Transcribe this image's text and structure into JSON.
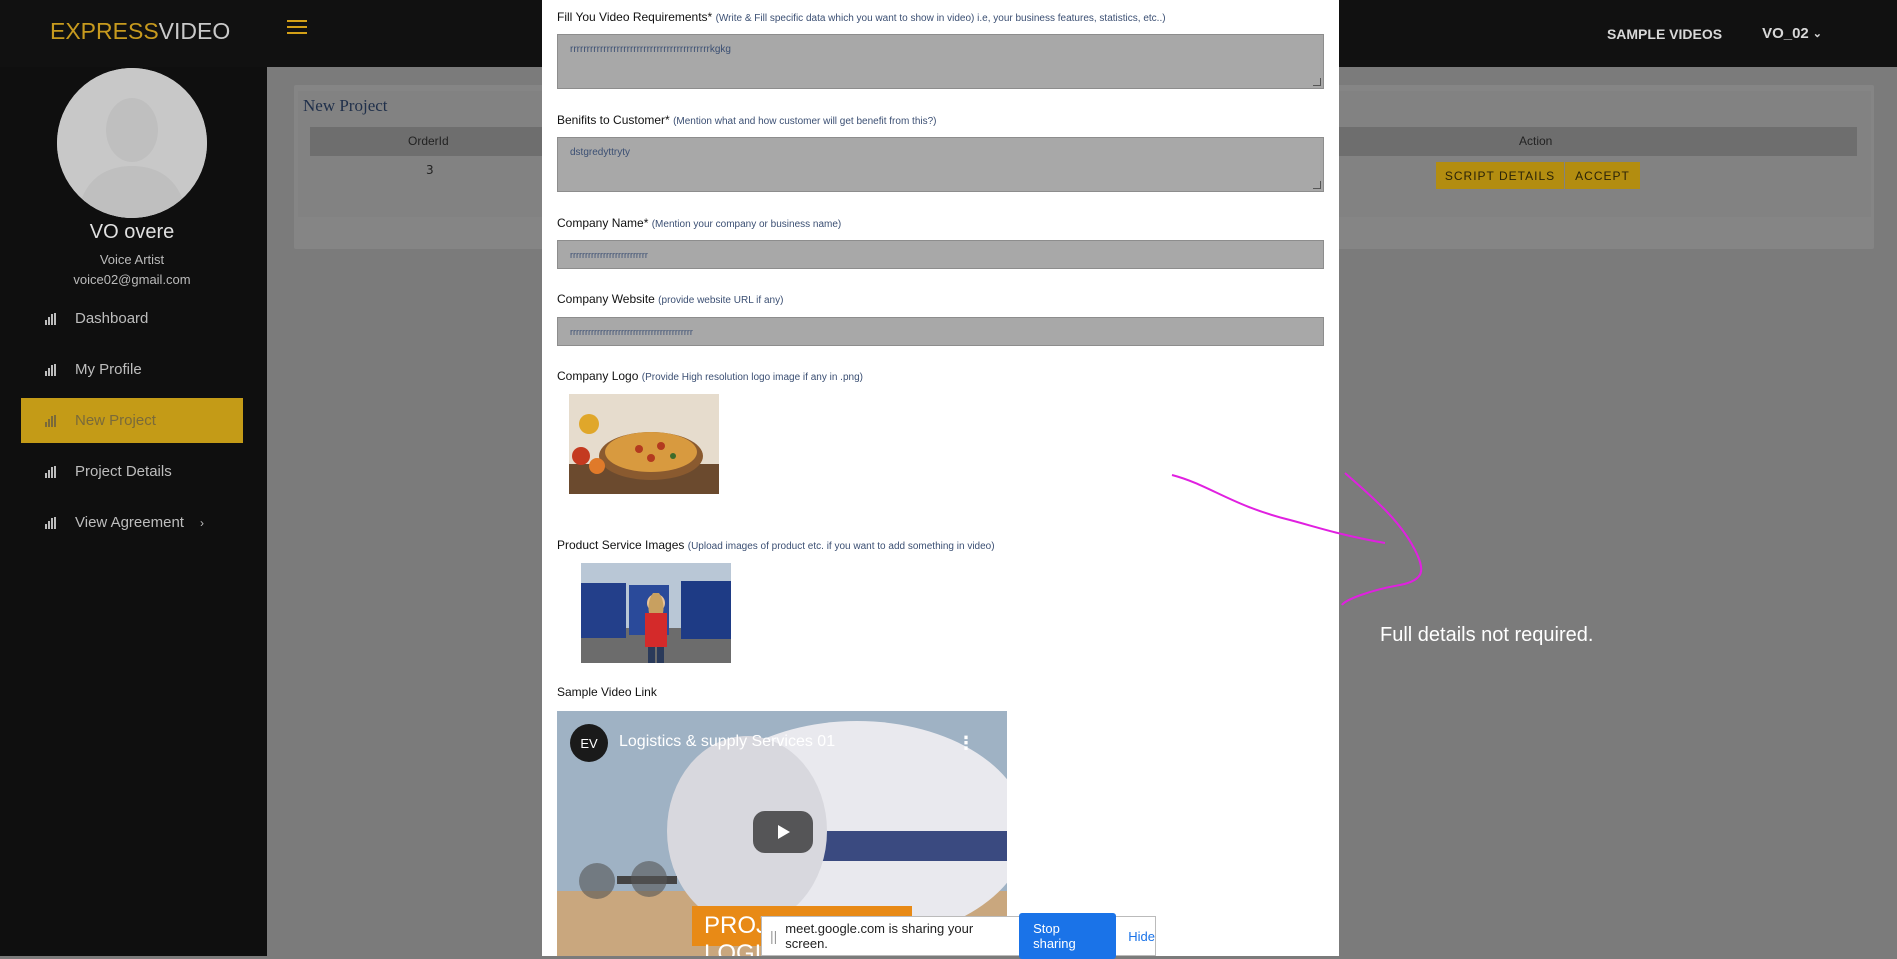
{
  "brand": {
    "express": "EXPRESS",
    "video": "VIDEO"
  },
  "topbar": {
    "sample_videos": "SAMPLE VIDEOS",
    "user": "VO_02"
  },
  "profile": {
    "name": "VO overe",
    "role": "Voice Artist",
    "email": "voice02@gmail.com"
  },
  "nav": [
    {
      "label": "Dashboard"
    },
    {
      "label": "My Profile"
    },
    {
      "label": "New Project"
    },
    {
      "label": "Project Details"
    },
    {
      "label": "View Agreement"
    }
  ],
  "project": {
    "title": "New Project",
    "col_orderid": "OrderId",
    "col_action": "Action",
    "orderid": "3",
    "btn_script": "SCRIPT DETAILS",
    "btn_accept": "ACCEPT"
  },
  "form": {
    "req_label": "Fill You Video Requirements*",
    "req_hint": "(Write & Fill specific data which you want to show in video) i.e, your business features, statistics, etc..)",
    "req_value": "rrrrrrrrrrrrrrrrrrrrrrrrrrrrrrrrrrrrrrrrrrkgkg",
    "ben_label": "Benifits to Customer*",
    "ben_hint": "(Mention what and how customer will get benefit from this?)",
    "ben_value": "dstgredyttryty",
    "company_label": "Company Name*",
    "company_hint": "(Mention your company or business name)",
    "company_value": "rrrrrrrrrrrrrrrrrrrrrrrrrr",
    "website_label": "Company Website",
    "website_hint": "(provide website URL if any)",
    "website_value": "rrrrrrrrrrrrrrrrrrrrrrrrrrrrrrrrrrrrrrrrr",
    "logo_label": "Company Logo",
    "logo_hint": "(Provide High resolution logo image if any in .png)",
    "product_label": "Product Service Images",
    "product_hint": "(Upload images of product etc. if you want to add something in video)",
    "sample_label": "Sample Video Link"
  },
  "video": {
    "channel": "EV",
    "title": "Logistics & supply Services 01",
    "banner": "PROJECT LOGISTICS"
  },
  "annotation": {
    "text": "Full details not required.",
    "color": "#e020e0"
  },
  "share": {
    "text": "meet.google.com is sharing your screen.",
    "stop": "Stop sharing",
    "hide": "Hide"
  }
}
